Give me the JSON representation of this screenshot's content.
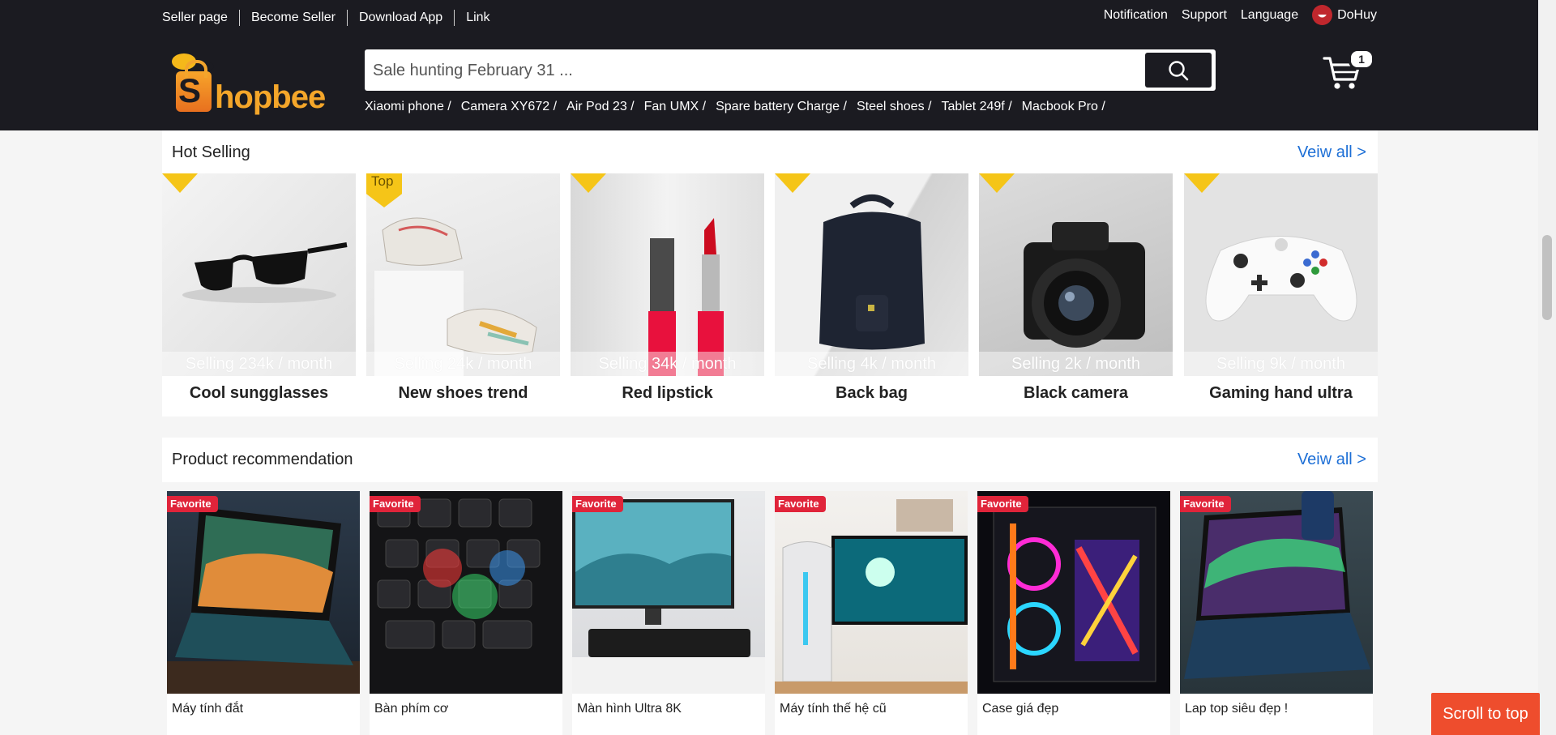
{
  "topbar": {
    "left_links": [
      "Seller page",
      "Become Seller",
      "Download App",
      "Link"
    ],
    "notification": "Notification",
    "support": "Support",
    "language": "Language",
    "username": "DoHuy"
  },
  "brand": {
    "logo_initial": "S",
    "logo_text": "hopbee"
  },
  "search": {
    "placeholder": "Sale hunting February 31 ...",
    "quick_links": [
      "Xiaomi phone /",
      "Camera XY672 /",
      "Air Pod 23 /",
      "Fan UMX /",
      "Spare battery Charge /",
      "Steel shoes /",
      "Tablet 249f /",
      "Macbook Pro /"
    ]
  },
  "cart": {
    "count": "1"
  },
  "hot_selling": {
    "title": "Hot Selling",
    "view_all": "Veiw all >",
    "items": [
      {
        "name": "Cool sungglasses",
        "selling": "Selling 234k / month",
        "flag": ""
      },
      {
        "name": "New shoes trend",
        "selling": "Selling 24k / month",
        "flag": "Top"
      },
      {
        "name": "Red lipstick",
        "selling": "Selling 34k / month",
        "flag": ""
      },
      {
        "name": "Back bag",
        "selling": "Selling 4k / month",
        "flag": ""
      },
      {
        "name": "Black camera",
        "selling": "Selling 2k / month",
        "flag": ""
      },
      {
        "name": "Gaming hand ultra",
        "selling": "Selling 9k / month",
        "flag": ""
      }
    ]
  },
  "recommendation": {
    "title": "Product recommendation",
    "view_all": "Veiw all >",
    "badge": "Favorite",
    "items": [
      {
        "name": "Máy tính đắt"
      },
      {
        "name": "Bàn phím cơ"
      },
      {
        "name": "Màn hình Ultra 8K"
      },
      {
        "name": "Máy tính thế hệ cũ"
      },
      {
        "name": "Case giá đẹp"
      },
      {
        "name": "Lap top siêu đẹp !"
      }
    ]
  },
  "scroll_to_top": "Scroll to top",
  "colors": {
    "header_bg": "#1b1b21",
    "link_blue": "#1d6fd6",
    "favorite_red": "#e0243a",
    "flag_yellow": "#f5c518",
    "scroll_btn": "#ee4d2d"
  }
}
